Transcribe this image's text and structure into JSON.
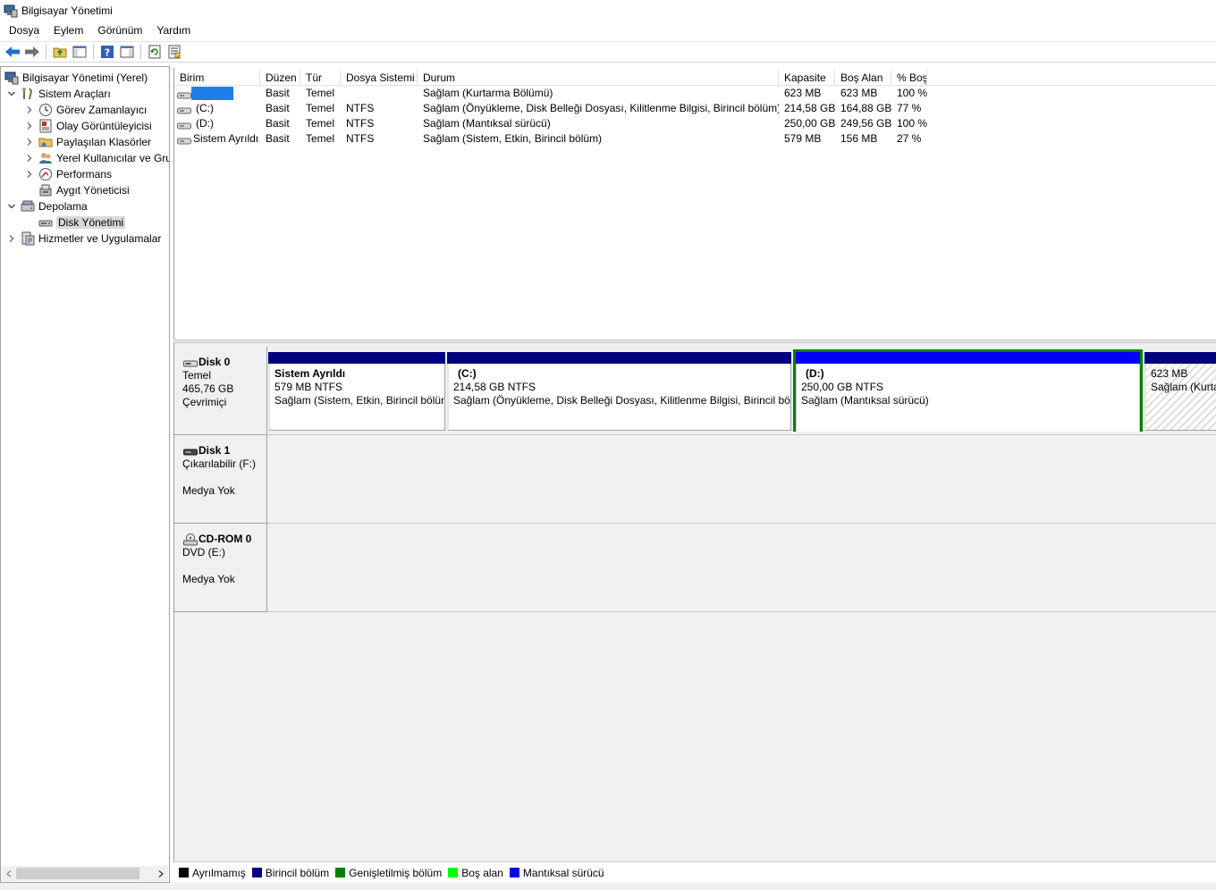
{
  "window": {
    "title": "Bilgisayar Yönetimi"
  },
  "menu": [
    "Dosya",
    "Eylem",
    "Görünüm",
    "Yardım"
  ],
  "toolbar": {
    "icons": [
      "back-arrow-icon",
      "forward-arrow-icon",
      "up-folder-icon",
      "show-hide-tree-icon",
      "help-icon",
      "show-hide-action-icon",
      "refresh-icon",
      "export-list-icon"
    ]
  },
  "tree": {
    "root": "Bilgisayar Yönetimi (Yerel)",
    "system_tools": "Sistem Araçları",
    "task_scheduler": "Görev Zamanlayıcı",
    "event_viewer": "Olay Görüntüleyicisi",
    "shared_folders": "Paylaşılan Klasörler",
    "local_users": "Yerel Kullanıcılar ve Gru",
    "performance": "Performans",
    "device_manager": "Aygıt Yöneticisi",
    "storage": "Depolama",
    "disk_management": "Disk Yönetimi",
    "services": "Hizmetler ve Uygulamalar"
  },
  "volumes": {
    "columns": [
      "Birim",
      "Düzen",
      "Tür",
      "Dosya Sistemi",
      "Durum",
      "Kapasite",
      "Boş Alan",
      "% Boş"
    ],
    "rows": [
      {
        "name": "",
        "layout": "Basit",
        "type": "Temel",
        "fs": "",
        "status": "Sağlam (Kurtarma Bölümü)",
        "capacity": "623 MB",
        "free": "623 MB",
        "pct": "100 %"
      },
      {
        "name": "(C:)",
        "layout": "Basit",
        "type": "Temel",
        "fs": "NTFS",
        "status": "Sağlam (Önyükleme, Disk Belleği Dosyası, Kilitlenme Bilgisi, Birincil bölüm)",
        "capacity": "214,58 GB",
        "free": "164,88 GB",
        "pct": "77 %"
      },
      {
        "name": "(D:)",
        "layout": "Basit",
        "type": "Temel",
        "fs": "NTFS",
        "status": "Sağlam (Mantıksal sürücü)",
        "capacity": "250,00 GB",
        "free": "249,56 GB",
        "pct": "100 %"
      },
      {
        "name": "Sistem Ayrıldı",
        "layout": "Basit",
        "type": "Temel",
        "fs": "NTFS",
        "status": "Sağlam (Sistem, Etkin, Birincil bölüm)",
        "capacity": "579 MB",
        "free": "156 MB",
        "pct": "27 %"
      }
    ]
  },
  "disks": [
    {
      "name": "Disk 0",
      "line1": "Temel",
      "line2": "465,76 GB",
      "line3": "Çevrimiçi"
    },
    {
      "name": "Disk 1",
      "line1": "Çıkarılabilir (F:)",
      "line2": "",
      "line3": "Medya Yok"
    },
    {
      "name": "CD-ROM 0",
      "line1": "DVD (E:)",
      "line2": "",
      "line3": "Medya Yok"
    }
  ],
  "partitions": [
    {
      "name": "Sistem Ayrıldı",
      "size": "579 MB NTFS",
      "status": "Sağlam (Sistem, Etkin, Birincil bölüm)",
      "kind": "primary"
    },
    {
      "name": "(C:)",
      "size": "214,58 GB NTFS",
      "status": "Sağlam (Önyükleme, Disk Belleği Dosyası, Kilitlenme Bilgisi, Birincil bölüm)",
      "kind": "primary"
    },
    {
      "name": "(D:)",
      "size": "250,00 GB NTFS",
      "status": "Sağlam (Mantıksal sürücü)",
      "kind": "logical",
      "selected": true
    },
    {
      "name": "",
      "size": "623 MB",
      "status": "Sağlam (Kurtarma Bölümü)",
      "kind": "primary"
    }
  ],
  "legend": [
    {
      "label": "Ayrılmamış",
      "color": "#000000"
    },
    {
      "label": "Birincil bölüm",
      "color": "#000080"
    },
    {
      "label": "Genişletilmiş bölüm",
      "color": "#008000"
    },
    {
      "label": "Boş alan",
      "color": "#00ff00"
    },
    {
      "label": "Mantıksal sürücü",
      "color": "#0000ff"
    }
  ],
  "colors": {
    "primary_bar": "#000080",
    "logical_bar": "#0000ff",
    "selection_border": "#008000"
  }
}
